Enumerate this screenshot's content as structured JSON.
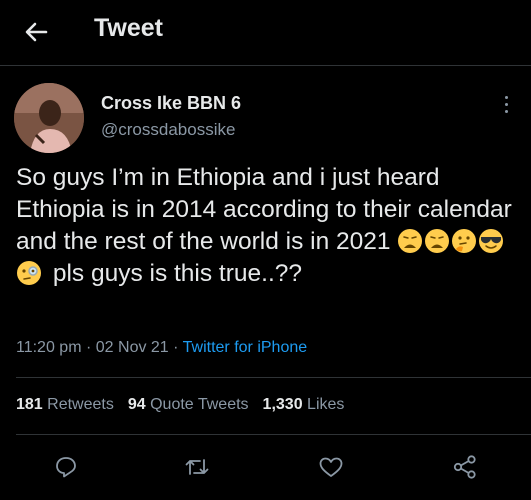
{
  "header": {
    "title": "Tweet",
    "back_icon": "arrow-left-icon"
  },
  "author": {
    "name": "Cross Ike BBN 6",
    "handle": "@crossdabossike"
  },
  "tweet": {
    "text_before": "So guys I’m in Ethiopia and i just heard Ethiopia is in 2014 according to their calendar and the rest of the world is in 2021",
    "emojis": [
      "weary-face",
      "weary-face",
      "thinking-face",
      "smiling-face-with-sunglasses",
      "face-with-monocle"
    ],
    "text_after": "pls guys is this true..??"
  },
  "meta": {
    "time": "11:20 pm",
    "date": "02 Nov 21",
    "source": "Twitter for iPhone",
    "sep": "·"
  },
  "stats": {
    "retweets_count": "181",
    "retweets_label": "Retweets",
    "quotes_count": "94",
    "quotes_label": "Quote Tweets",
    "likes_count": "1,330",
    "likes_label": "Likes"
  },
  "actions": [
    "reply-icon",
    "retweet-icon",
    "like-icon",
    "share-icon"
  ],
  "colors": {
    "background": "#000000",
    "text": "#e7e9ea",
    "secondary": "#8b98a5",
    "link": "#1d9bf0",
    "divider": "#2f3336"
  }
}
